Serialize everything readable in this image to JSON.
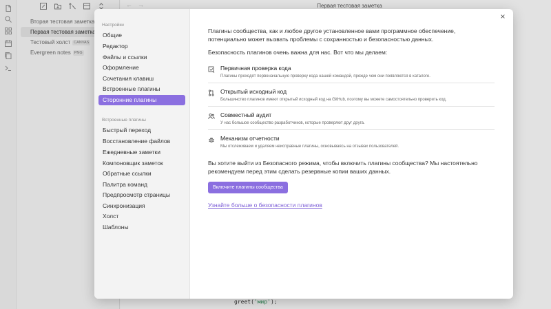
{
  "editor": {
    "title": "Первая тестовая заметка",
    "code": {
      "prefix": "greet(",
      "arg": "'мир'",
      "suffix": ");"
    },
    "nav": {
      "back": "←",
      "forward": "→"
    }
  },
  "ribbon": {
    "icons": [
      "files-icon",
      "search-icon",
      "graph-icon",
      "calendar-icon",
      "copy-icon",
      "terminal-icon"
    ]
  },
  "file_pane": {
    "files": [
      {
        "name": "Вторая тестовая заметка",
        "badge": ""
      },
      {
        "name": "Первая тестовая заметка",
        "badge": "",
        "active": true
      },
      {
        "name": "Тестовый холст",
        "badge": "CANVAS"
      },
      {
        "name": "Evergreen notes",
        "badge": "PNG"
      }
    ]
  },
  "settings": {
    "close_label": "×",
    "sidebar": {
      "group1_label": "Настройки",
      "group1_items": [
        "Общие",
        "Редактор",
        "Файлы и ссылки",
        "Оформление",
        "Сочетания клавиш",
        "Встроенные плагины",
        "Сторонние плагины"
      ],
      "group2_label": "Встроенные плагины",
      "group2_items": [
        "Быстрый переход",
        "Восстановление файлов",
        "Ежедневные заметки",
        "Компоновщик заметок",
        "Обратные ссылки",
        "Палитра команд",
        "Предпросмотр страницы",
        "Синхронизация",
        "Холст",
        "Шаблоны"
      ]
    },
    "content": {
      "intro": "Плагины сообщества, как и любое другое установленное вами программное обеспечение, потенциально может вызвать проблемы с сохранностью и безопасностью данных.",
      "security_heading": "Безопасность плагинов очень важна для нас. Вот что мы делаем:",
      "features": [
        {
          "icon": "code-review-icon",
          "title": "Первичная проверка кода",
          "desc": "Плагины проходят первоначальную проверку кода нашей командой, прежде чем они появляются в каталоге."
        },
        {
          "icon": "git-pull-request-icon",
          "title": "Открытый исходный код",
          "desc": "Большинство плагинов имеют открытый исходный код на GitHub, поэтому вы можете самостоятельно проверить код."
        },
        {
          "icon": "users-icon",
          "title": "Совместный аудит",
          "desc": "У нас большое сообщество разработчиков, которые проверяют друг друга."
        },
        {
          "icon": "bug-icon",
          "title": "Механизм отчетности",
          "desc": "Мы отслеживаем и удаляем неисправные плагины, основываясь на отзывах пользователей."
        }
      ],
      "question": "Вы хотите выйти из Безопасного режима, чтобы включить плагины сообщества? Мы настоятельно рекомендуем перед этим сделать резервные копии ваших данных.",
      "enable_button": "Включите плагины сообщества",
      "learn_more_link": "Узнайте больше о безопасности плагинов"
    }
  },
  "colors": {
    "accent": "#8b6fe0",
    "link": "#7b5cd6"
  }
}
